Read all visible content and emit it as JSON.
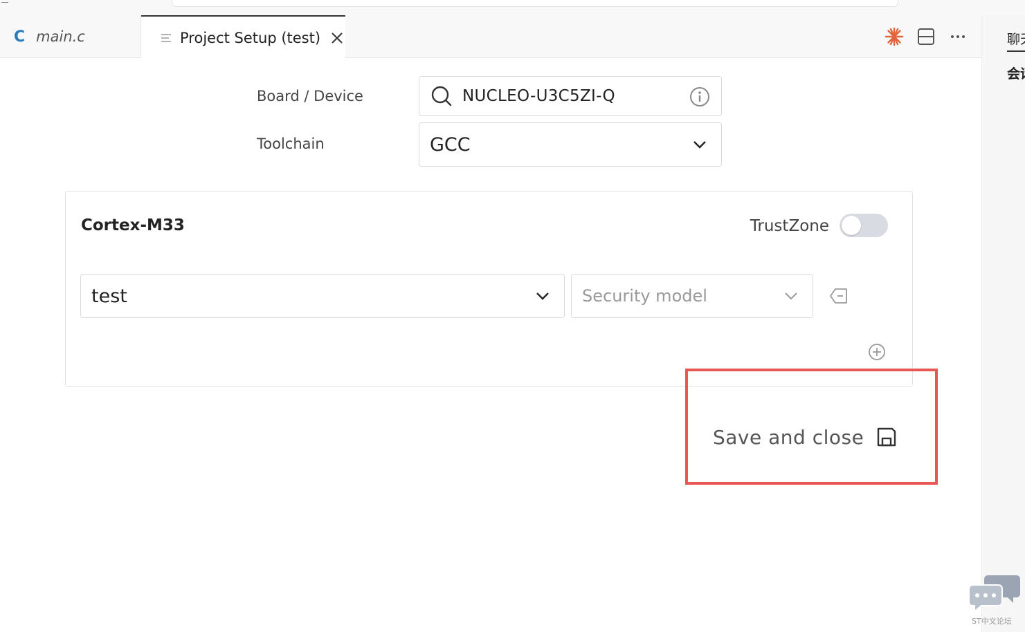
{
  "tabs": {
    "main": {
      "icon_letter": "C",
      "label": "main.c"
    },
    "setup": {
      "label": "Project Setup (test)"
    }
  },
  "side_panel": {
    "title_1": "聊天",
    "title_2": "会话"
  },
  "form": {
    "board_label": "Board / Device",
    "board_value": "NUCLEO-U3C5ZI-Q",
    "toolchain_label": "Toolchain",
    "toolchain_value": "GCC"
  },
  "core": {
    "title": "Cortex-M33",
    "trustzone_label": "TrustZone",
    "trustzone_on": false,
    "project_value": "test",
    "security_placeholder": "Security model"
  },
  "actions": {
    "save_label": "Save and close"
  },
  "watermark": {
    "text": "ST中文论坛"
  },
  "colors": {
    "accent_spark": "#e0643c",
    "highlight": "#e85656",
    "c_icon": "#2a7ab8"
  }
}
